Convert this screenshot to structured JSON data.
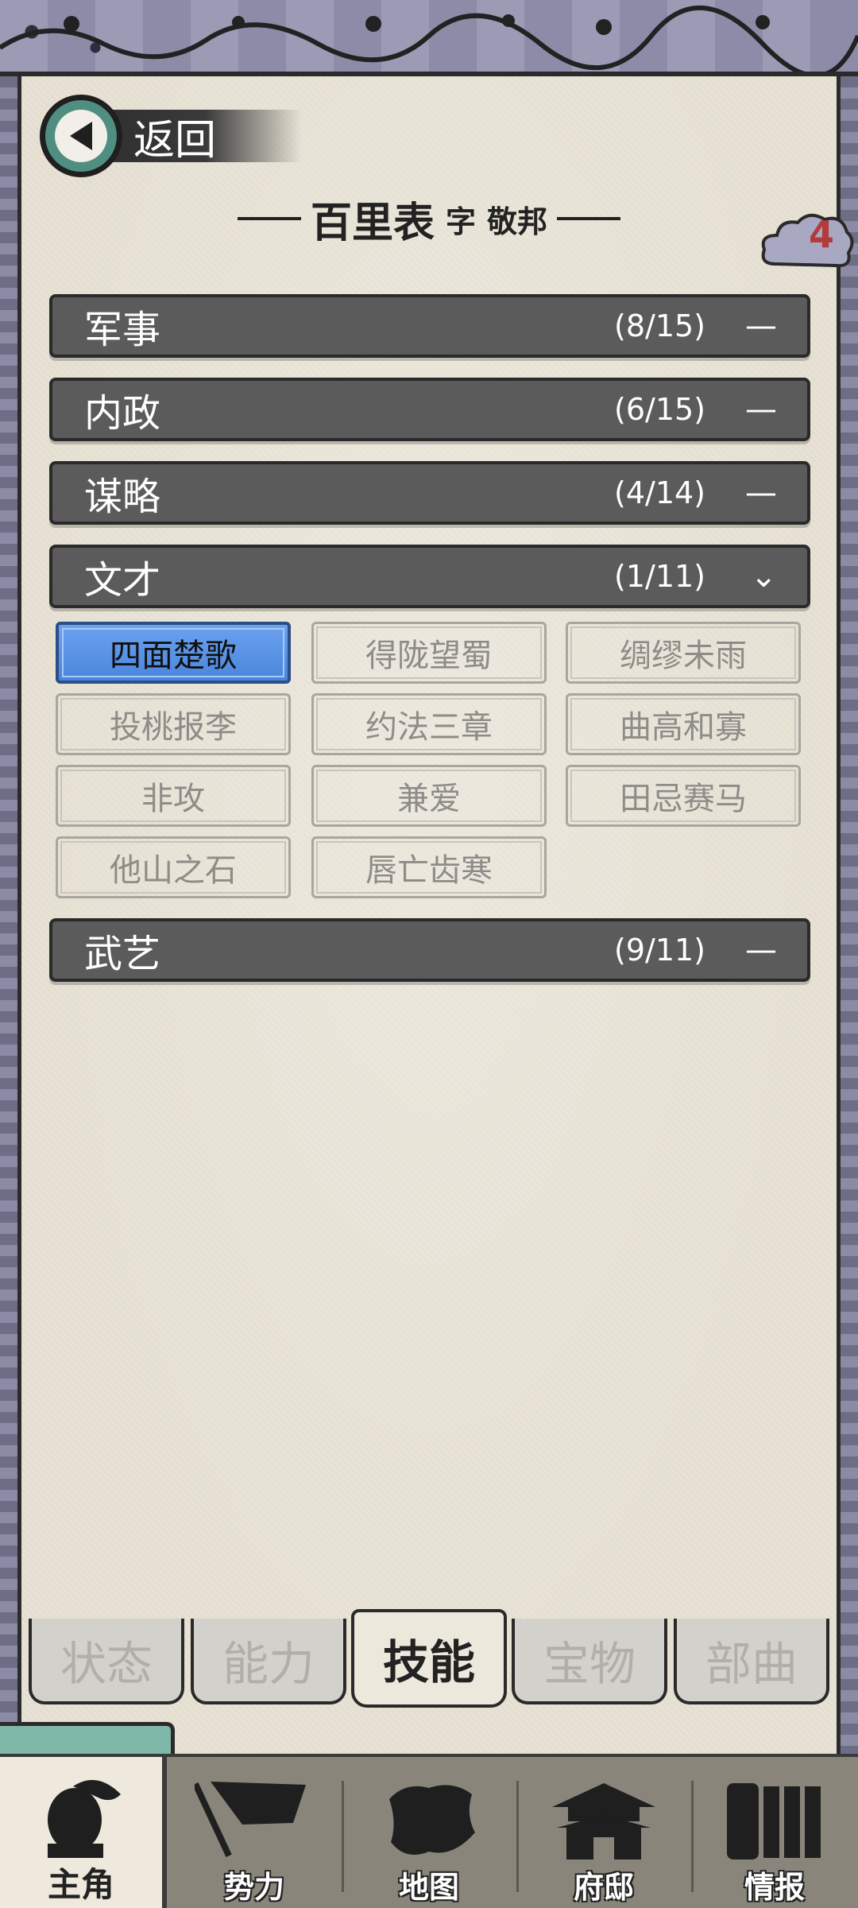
{
  "back_label": "返回",
  "character": {
    "name": "百里表",
    "courtesy_prefix": "字",
    "courtesy_name": "敬邦"
  },
  "badge_count": "4",
  "categories": [
    {
      "name": "军事",
      "count": "(8/15)",
      "toggle": "—"
    },
    {
      "name": "内政",
      "count": "(6/15)",
      "toggle": "—"
    },
    {
      "name": "谋略",
      "count": "(4/14)",
      "toggle": "—"
    },
    {
      "name": "文才",
      "count": "(1/11)",
      "toggle": "⌄"
    },
    {
      "name": "武艺",
      "count": "(9/11)",
      "toggle": "—"
    }
  ],
  "skills": [
    "四面楚歌",
    "得陇望蜀",
    "绸缪未雨",
    "投桃报李",
    "约法三章",
    "曲高和寡",
    "非攻",
    "兼爱",
    "田忌赛马",
    "他山之石",
    "唇亡齿寒"
  ],
  "tabs": [
    "状态",
    "能力",
    "技能",
    "宝物",
    "部曲"
  ],
  "active_tab": "技能",
  "nav": [
    {
      "label": "主角",
      "icon": "hero-icon"
    },
    {
      "label": "势力",
      "icon": "flag-icon"
    },
    {
      "label": "地图",
      "icon": "map-icon"
    },
    {
      "label": "府邸",
      "icon": "mansion-icon"
    },
    {
      "label": "情报",
      "icon": "scroll-icon"
    }
  ],
  "colors": {
    "header_bar": "#5b5b5b",
    "active_skill": "#4a86dd",
    "paper": "#e7e2d4",
    "back_circle": "#4f8e80",
    "badge_number": "#b23b3b"
  }
}
